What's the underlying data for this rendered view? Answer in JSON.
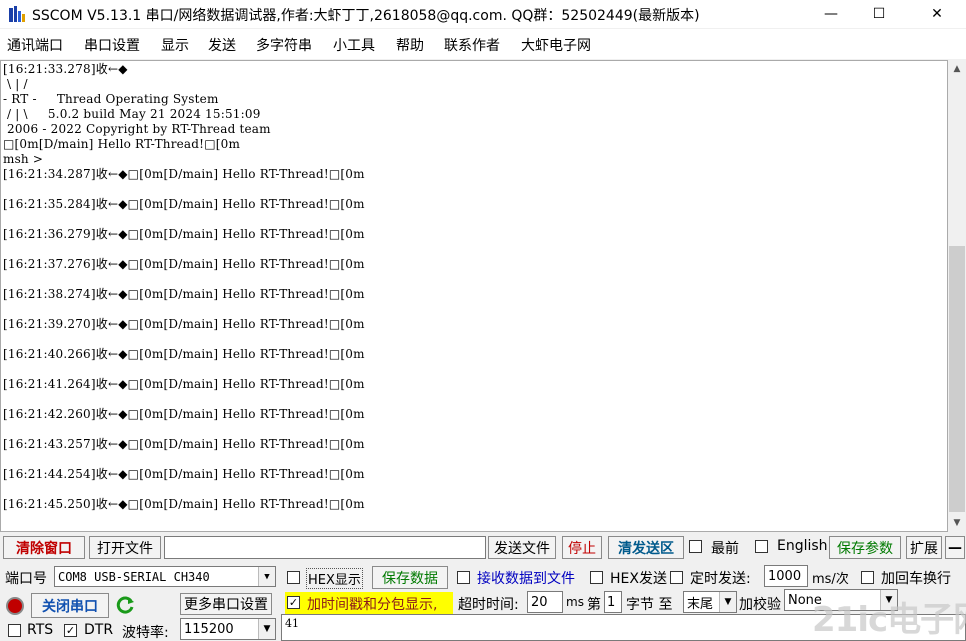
{
  "window": {
    "title": "SSCOM V5.13.1 串口/网络数据调试器,作者:大虾丁丁,2618058@qq.com. QQ群：52502449(最新版本)",
    "minimize": "—",
    "maximize": "☐",
    "close": "✕"
  },
  "menu": [
    "通讯端口",
    "串口设置",
    "显示",
    "发送",
    "多字符串",
    "小工具",
    "帮助",
    "联系作者",
    "大虾电子网"
  ],
  "terminal": {
    "lines": [
      "[16:21:33.278]收←◆",
      " \\ | /",
      "- RT -     Thread Operating System",
      " / | \\     5.0.2 build May 21 2024 15:51:09",
      " 2006 - 2022 Copyright by RT-Thread team",
      "□[0m[D/main] Hello RT-Thread!□[0m",
      "msh >",
      "[16:21:34.287]收←◆□[0m[D/main] Hello RT-Thread!□[0m",
      "",
      "[16:21:35.284]收←◆□[0m[D/main] Hello RT-Thread!□[0m",
      "",
      "[16:21:36.279]收←◆□[0m[D/main] Hello RT-Thread!□[0m",
      "",
      "[16:21:37.276]收←◆□[0m[D/main] Hello RT-Thread!□[0m",
      "",
      "[16:21:38.274]收←◆□[0m[D/main] Hello RT-Thread!□[0m",
      "",
      "[16:21:39.270]收←◆□[0m[D/main] Hello RT-Thread!□[0m",
      "",
      "[16:21:40.266]收←◆□[0m[D/main] Hello RT-Thread!□[0m",
      "",
      "[16:21:41.264]收←◆□[0m[D/main] Hello RT-Thread!□[0m",
      "",
      "[16:21:42.260]收←◆□[0m[D/main] Hello RT-Thread!□[0m",
      "",
      "[16:21:43.257]收←◆□[0m[D/main] Hello RT-Thread!□[0m",
      "",
      "[16:21:44.254]收←◆□[0m[D/main] Hello RT-Thread!□[0m",
      "",
      "[16:21:45.250]收←◆□[0m[D/main] Hello RT-Thread!□[0m"
    ]
  },
  "toolbar1": {
    "clear_window": "清除窗口",
    "open_file": "打开文件",
    "file_path": "",
    "send_file": "发送文件",
    "stop": "停止",
    "clear_send": "清发送区",
    "last": "最前",
    "last_checked": false,
    "english": "English",
    "english_checked": false,
    "save_params": "保存参数",
    "expand": "扩展",
    "collapse": "—"
  },
  "row2": {
    "port_label": "端口号",
    "port_value": "COM8 USB-SERIAL CH340",
    "hex_display": "HEX显示",
    "hex_display_checked": false,
    "save_data": "保存数据",
    "recv_to_file": "接收数据到文件",
    "recv_to_file_checked": false,
    "hex_send": "HEX发送",
    "hex_send_checked": false,
    "timed_send": "定时发送:",
    "timed_send_checked": false,
    "interval": "1000",
    "interval_unit": "ms/次",
    "add_crlf": "加回车换行",
    "add_crlf_checked": false
  },
  "row3": {
    "close_port": "关闭串口",
    "more_settings": "更多串口设置",
    "timestamp": "加时间戳和分包显示,",
    "timestamp_checked": true,
    "timeout_label": "超时时间:",
    "timeout_value": "20",
    "timeout_unit": "ms",
    "byte_label_pre": "第",
    "byte_value": "1",
    "byte_label_post": "字节 至",
    "byte_end": "末尾",
    "checksum_label": "加校验",
    "checksum_value": "None"
  },
  "row4": {
    "rts": "RTS",
    "rts_checked": false,
    "dtr": "DTR",
    "dtr_checked": true,
    "baud_label": "波特率:",
    "baud_value": "115200",
    "send_text": "41"
  },
  "watermark": "21ic电子网"
}
